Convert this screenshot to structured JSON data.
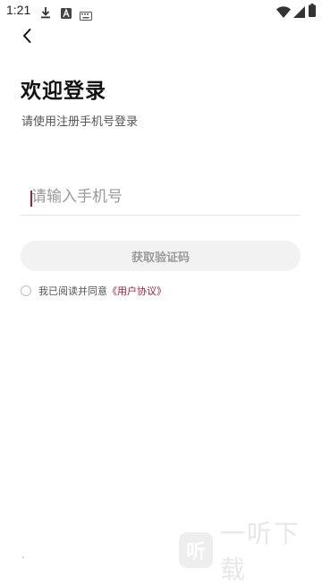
{
  "status_bar": {
    "time": "1:21"
  },
  "header": {
    "back_icon": "chevron-left-icon"
  },
  "main": {
    "title": "欢迎登录",
    "subtitle": "请使用注册手机号登录",
    "phone_placeholder": "请输入手机号",
    "get_code_label": "获取验证码",
    "agree_text": "我已阅读并同意",
    "agreement_link": "《用户协议》"
  },
  "watermark": {
    "logo_char": "听",
    "text": "一听下载"
  },
  "colors": {
    "accent": "#a0223a",
    "button_bg": "#f2f2f2"
  }
}
